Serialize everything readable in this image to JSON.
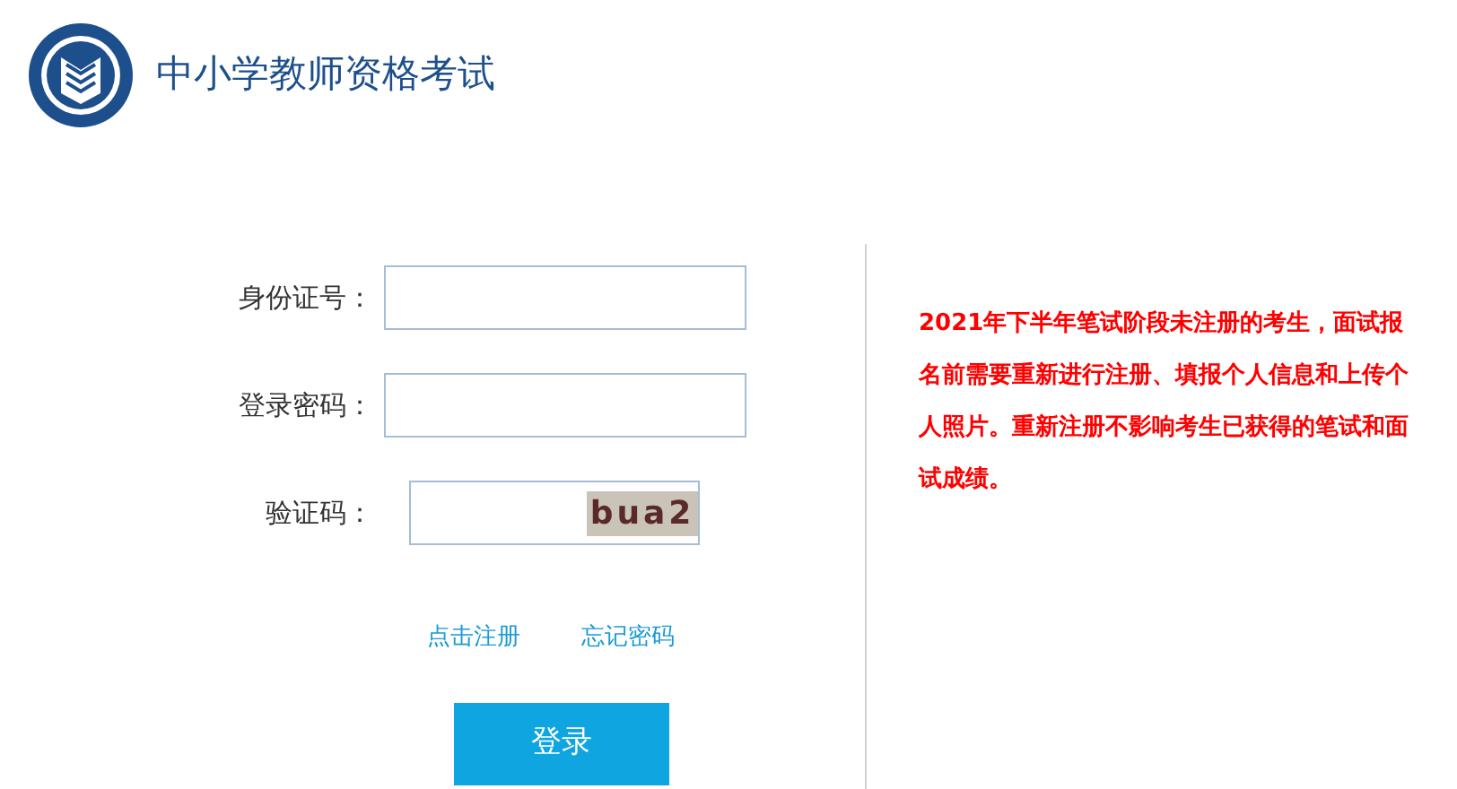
{
  "header": {
    "title": "中小学教师资格考试"
  },
  "form": {
    "fields": [
      {
        "label": "身份证号："
      },
      {
        "label": "登录密码："
      }
    ],
    "captcha": {
      "label": "验证码：",
      "code": "bua2"
    },
    "links": [
      "点击注册",
      "忘记密码"
    ],
    "submit": "登录"
  },
  "notice": {
    "text": "2021年下半年笔试阶段未注册的考生，面试报名前需要重新进行注册、填报个人信息和上传个人照片。重新注册不影响考生已获得的笔试和面试成绩。"
  }
}
